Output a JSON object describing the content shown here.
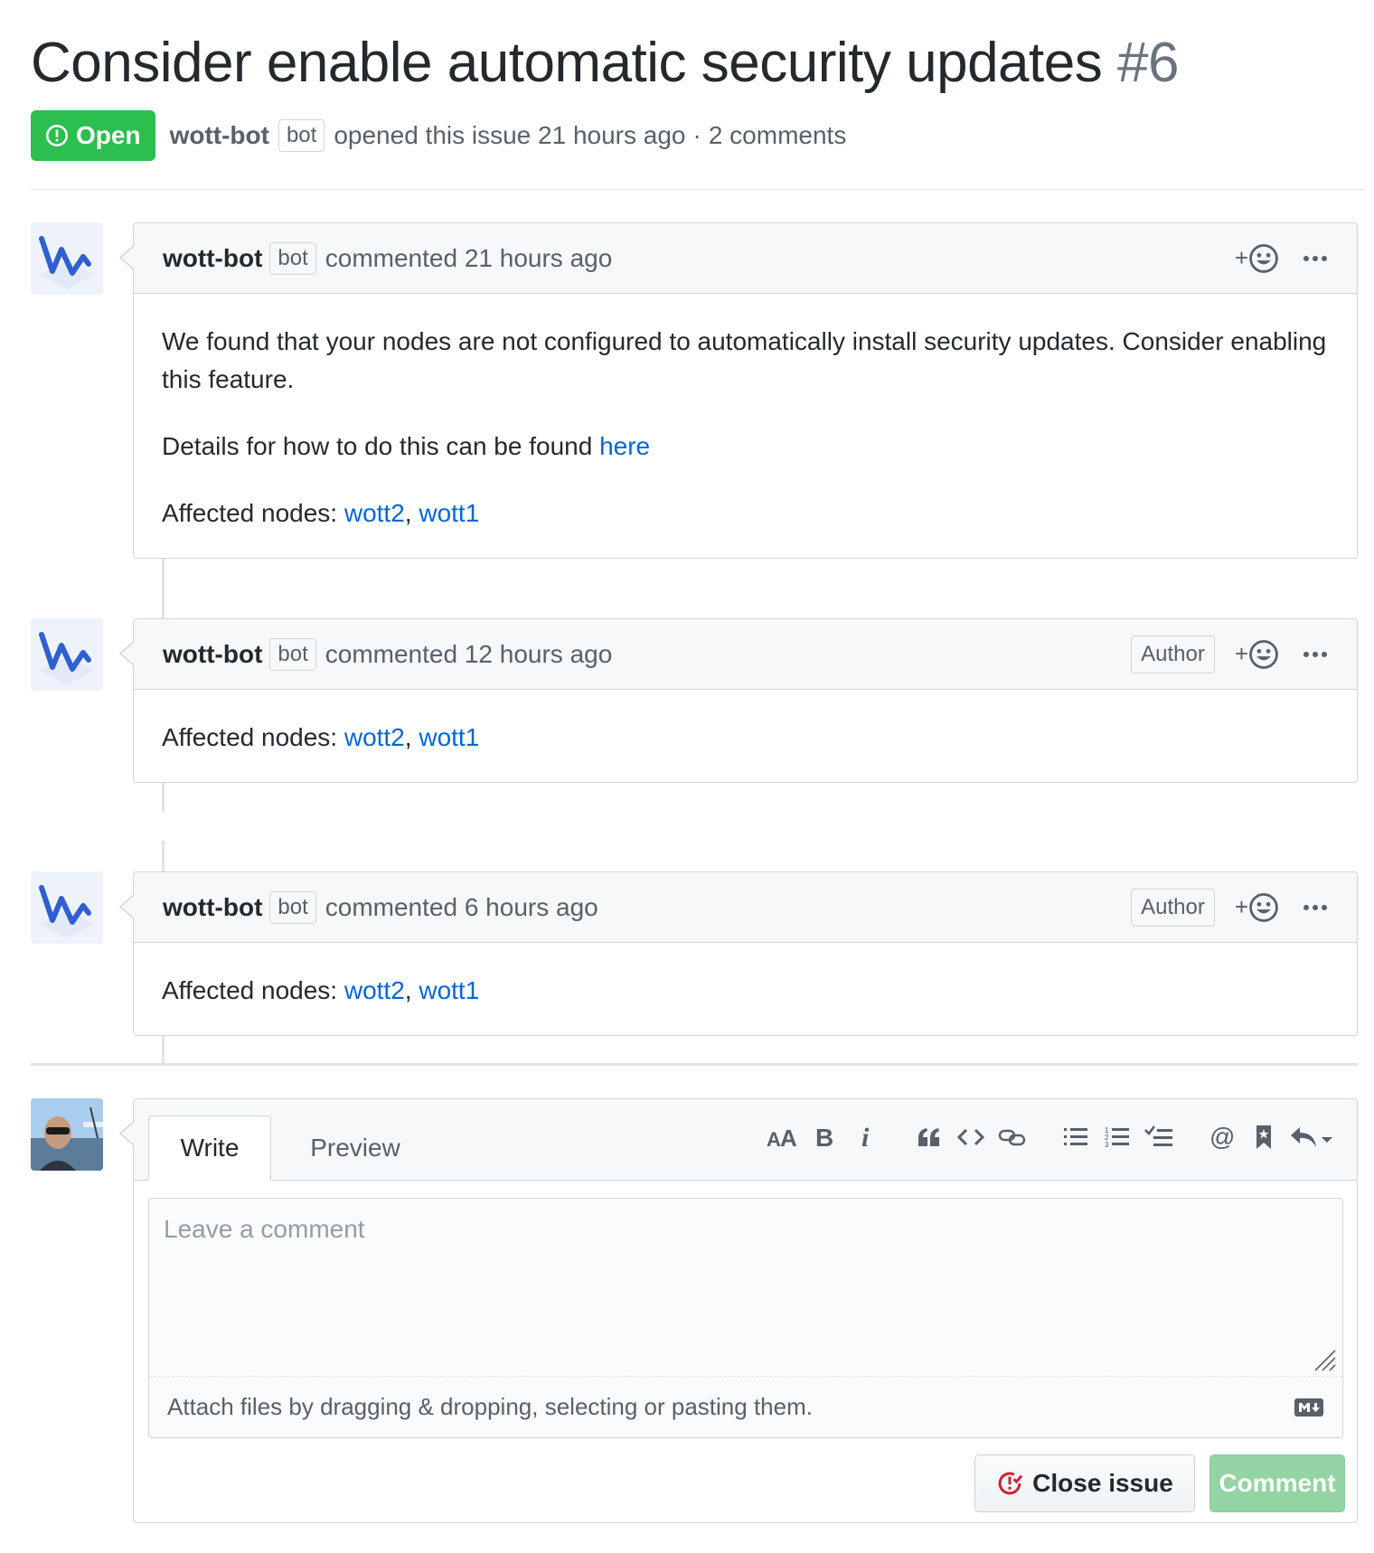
{
  "issue": {
    "title": "Consider enable automatic security updates",
    "number": "#6",
    "state": "Open",
    "author": "wott-bot",
    "author_label": "bot",
    "opened_text": "opened this issue 21 hours ago",
    "separator": "·",
    "comment_count": "2 comments"
  },
  "comments": [
    {
      "author": "wott-bot",
      "bot_label": "bot",
      "time_text": "commented 21 hours ago",
      "author_badge": "",
      "reaction_plus": "+",
      "body": {
        "paragraph1": "We found that your nodes are not configured to automatically install security updates. Consider enabling this feature.",
        "details_prefix": "Details for how to do this can be found ",
        "details_link": "here",
        "affected_prefix": "Affected nodes: ",
        "node1": "wott2",
        "comma": ", ",
        "node2": "wott1"
      }
    },
    {
      "author": "wott-bot",
      "bot_label": "bot",
      "time_text": "commented 12 hours ago",
      "author_badge": "Author",
      "reaction_plus": "+",
      "body": {
        "affected_prefix": "Affected nodes: ",
        "node1": "wott2",
        "comma": ", ",
        "node2": "wott1"
      }
    },
    {
      "author": "wott-bot",
      "bot_label": "bot",
      "time_text": "commented 6 hours ago",
      "author_badge": "Author",
      "reaction_plus": "+",
      "body": {
        "affected_prefix": "Affected nodes: ",
        "node1": "wott2",
        "comma": ", ",
        "node2": "wott1"
      }
    }
  ],
  "composer": {
    "tab_write": "Write",
    "tab_preview": "Preview",
    "placeholder": "Leave a comment",
    "attach_text": "Attach files by dragging & dropping, selecting or pasting them.",
    "close_button": "Close issue",
    "comment_button": "Comment",
    "toolbar_icons": [
      "text-size-icon",
      "bold-icon",
      "italic-icon",
      "quote-icon",
      "code-icon",
      "link-icon",
      "unordered-list-icon",
      "ordered-list-icon",
      "task-list-icon",
      "mention-icon",
      "saved-reply-icon",
      "reply-icon"
    ]
  },
  "colors": {
    "open_green": "#2cbe4e",
    "link_blue": "#0366d6",
    "comment_button_disabled": "#94d3a2",
    "close_icon_red": "#cb2431"
  }
}
